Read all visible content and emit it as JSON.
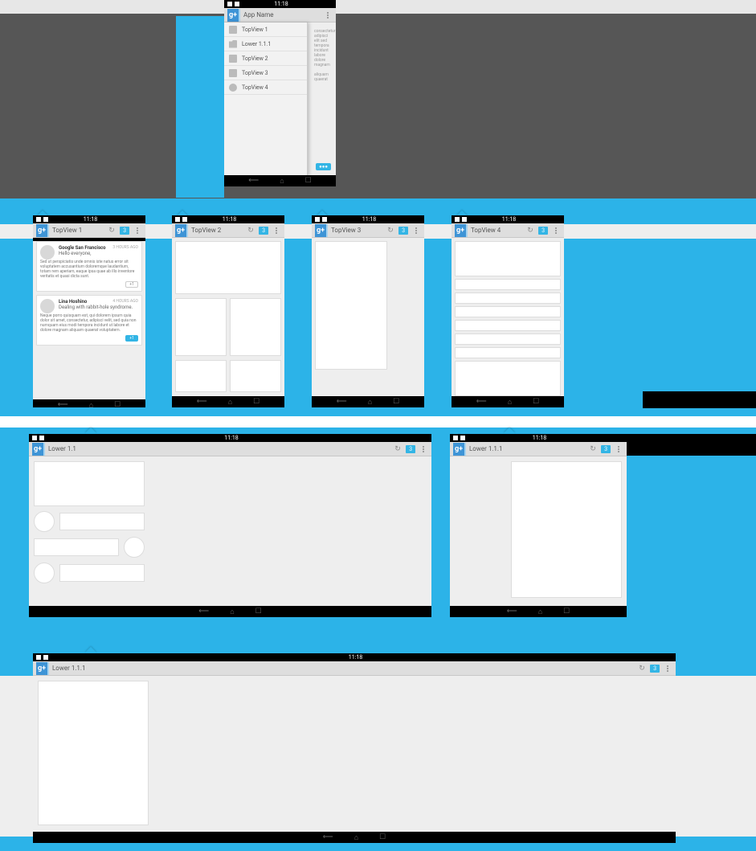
{
  "statusbar": {
    "clock": "11:18"
  },
  "s0": {
    "title": "App Name",
    "drawer": [
      {
        "label": "TopView 1",
        "icon": "box"
      },
      {
        "label": "Lower 1.1.1",
        "icon": "folder"
      },
      {
        "label": "TopView 2",
        "icon": "box"
      },
      {
        "label": "TopView 3",
        "icon": "tag"
      },
      {
        "label": "TopView 4",
        "icon": "circ"
      }
    ],
    "chip": "●●●"
  },
  "badge": "3",
  "screens": {
    "p1": {
      "title": "TopView 1",
      "posts": [
        {
          "author": "Google San Francisco",
          "meta": "3 HOURS AGO",
          "hello": "Hello everyone,",
          "body": "Sed ut perspiciatis unde omnis iste natus error sit voluptatem accusantium doloremque laudantium, totam rem aperiam, eaque ipsa quae ab illo inventore veritatis et quasi dicta sunt.",
          "plusone": "+1",
          "active": false
        },
        {
          "author": "Lina Hoshino",
          "meta": "4 HOURS AGO",
          "hello": "Dealing with rabbit-hole syndrome.",
          "body": "Neque porro quisquam est, qui dolorem ipsum quia dolor sit amet, consectetur, adipisci velit, sed quia non numquam eius modi tempora incidunt ut labore et dolore magnam aliquam quaerat voluptatem.",
          "plusone": "+1",
          "active": true
        }
      ]
    },
    "p2": {
      "title": "TopView 2"
    },
    "p3": {
      "title": "TopView 3"
    },
    "p4": {
      "title": "TopView 4"
    },
    "tab1": {
      "title": "Lower 1.1"
    },
    "tab2": {
      "title": "Lower 1.1.1"
    },
    "tab3": {
      "title": "Lower 1.1.1"
    }
  }
}
